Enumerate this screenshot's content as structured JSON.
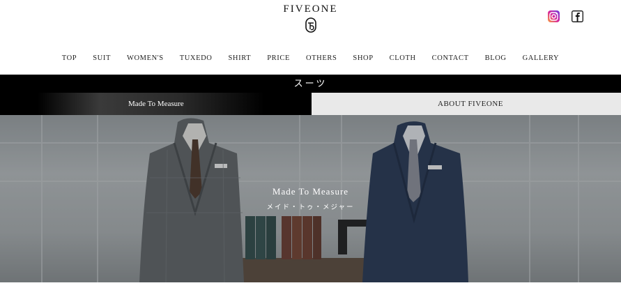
{
  "brand": {
    "name": "FIVEONE",
    "logo_icon": "fiveone-monogram-icon"
  },
  "social": [
    {
      "name": "instagram-icon",
      "color": "#c13584"
    },
    {
      "name": "facebook-icon",
      "color": "#111111"
    }
  ],
  "nav": [
    "TOP",
    "SUIT",
    "WOMEN'S",
    "TUXEDO",
    "SHIRT",
    "PRICE",
    "OTHERS",
    "SHOP",
    "CLOTH",
    "CONTACT",
    "BLOG",
    "GALLERY"
  ],
  "category_bar": {
    "title": "スーツ"
  },
  "tabs": {
    "left": "Made To Measure",
    "right": "ABOUT FIVEONE"
  },
  "hero": {
    "title": "Made To Measure",
    "subtitle": "メイド・トゥ・メジャー"
  },
  "colors": {
    "bar": "#000000",
    "tab_right_bg": "#e9e9e9"
  }
}
